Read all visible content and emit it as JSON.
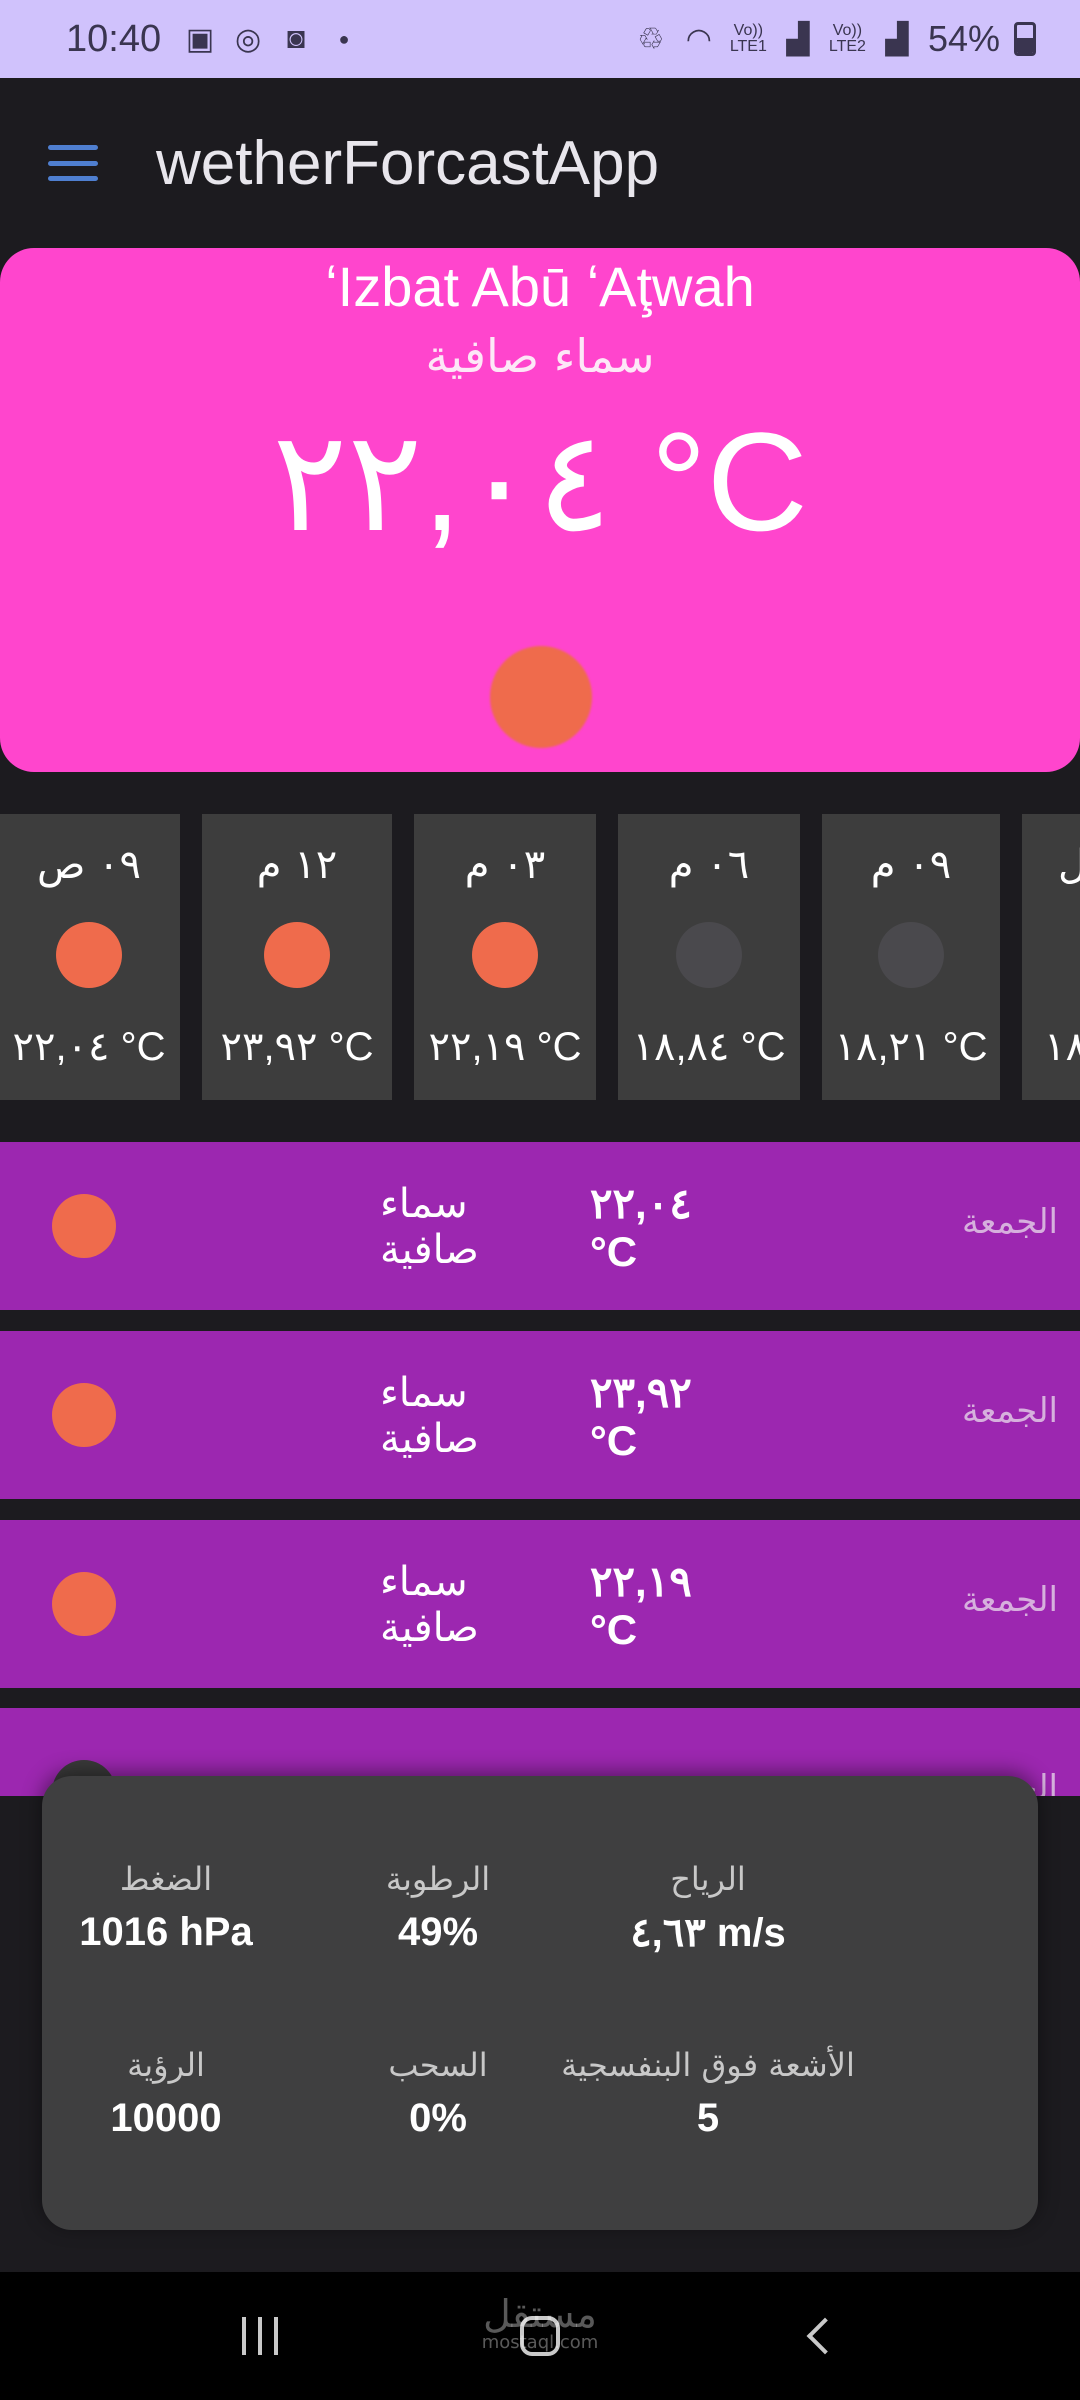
{
  "status_bar": {
    "time": "10:40",
    "net1": "Vo))\nLTE1",
    "net2": "Vo))\nLTE2",
    "battery": "54%",
    "battery_level": 0.54
  },
  "app_bar": {
    "title": "wetherForcastApp"
  },
  "current": {
    "city": "ʻIzbat Abū ʻAţwah",
    "description": "سماء صافية",
    "temperature": "٢٢,٠٤ °C",
    "icon": "sun-icon"
  },
  "hourly": [
    {
      "time": "٠٩ ص",
      "temp": "٢٢,٠٤ °C",
      "icon": "sun"
    },
    {
      "time": "١٢ م",
      "temp": "٢٣,٩٢ °C",
      "icon": "sun"
    },
    {
      "time": "٠٣ م",
      "temp": "٢٢,١٩ °C",
      "icon": "sun"
    },
    {
      "time": "٠٦ م",
      "temp": "١٨,٨٤ °C",
      "icon": "moon"
    },
    {
      "time": "٠٩ م",
      "temp": "١٨,٢١ °C",
      "icon": "moon"
    },
    {
      "time": "ل",
      "temp": "١٨",
      "icon": "moon"
    }
  ],
  "daily": [
    {
      "day": "الجمعة",
      "description": "سماء صافية",
      "temp": "٢٢,٠٤ °C"
    },
    {
      "day": "الجمعة",
      "description": "سماء صافية",
      "temp": "٢٣,٩٢ °C"
    },
    {
      "day": "الجمعة",
      "description": "سماء صافية",
      "temp": "٢٢,١٩ °C"
    },
    {
      "day": "الجمعة",
      "description": "",
      "temp": ""
    }
  ],
  "details": [
    {
      "label": "الرياح",
      "value": "٤,٦٣ m/s"
    },
    {
      "label": "الرطوبة",
      "value": "49%"
    },
    {
      "label": "الضغط",
      "value": "1016 hPa"
    },
    {
      "label": "الأشعة فوق البنفسجية",
      "value": "5"
    },
    {
      "label": "السحب",
      "value": "0%"
    },
    {
      "label": "الرؤية",
      "value": "10000"
    }
  ],
  "watermark": {
    "text": "مستقل",
    "sub": "mostaql.com"
  },
  "colors": {
    "hero": "#ff45cd",
    "daily_row": "#9c27b0",
    "sun": "#ef6b4c",
    "card": "#3d3d3d"
  }
}
